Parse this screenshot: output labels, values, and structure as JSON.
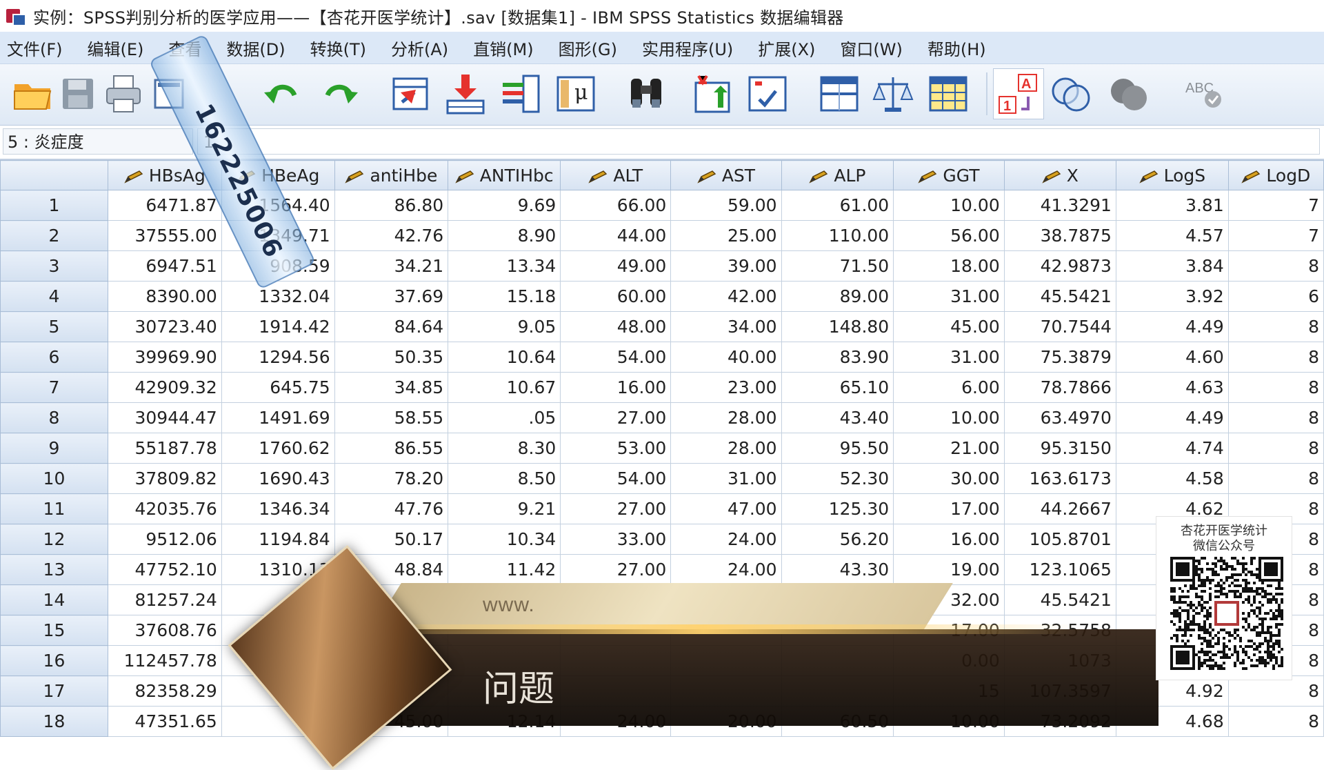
{
  "window": {
    "title": "实例：SPSS判别分析的医学应用——【杏花开医学统计】.sav [数据集1] - IBM SPSS Statistics 数据编辑器"
  },
  "menu": [
    "文件(F)",
    "编辑(E)",
    "查看",
    "数据(D)",
    "转换(T)",
    "分析(A)",
    "直销(M)",
    "图形(G)",
    "实用程序(U)",
    "扩展(X)",
    "窗口(W)",
    "帮助(H)"
  ],
  "toolbar": {
    "icons": [
      "open-folder-icon",
      "save-icon",
      "print-icon",
      "dialog-recall-icon",
      "undo-icon",
      "redo-icon",
      "go-to-case-icon",
      "go-to-variable-icon",
      "variables-icon",
      "run-descriptives-icon",
      "find-icon",
      "insert-cases-icon",
      "insert-variable-icon",
      "split-file-icon",
      "weight-cases-icon",
      "select-cases-icon",
      "value-labels-icon",
      "use-variable-sets-icon",
      "show-all-variables-icon",
      "spell-check-icon"
    ]
  },
  "cell_reference": {
    "label": "5 : 炎症度",
    "value": "1"
  },
  "grid": {
    "columns": [
      "HBsAg",
      "HBeAg",
      "antiHbe",
      "ANTIHbc",
      "ALT",
      "AST",
      "ALP",
      "GGT",
      "X",
      "LogS",
      "LogD"
    ],
    "rows": [
      {
        "n": "1",
        "cells": [
          "6471.87",
          "1564.40",
          "86.80",
          "9.69",
          "66.00",
          "59.00",
          "61.00",
          "10.00",
          "41.3291",
          "3.81",
          "7"
        ]
      },
      {
        "n": "2",
        "cells": [
          "37555.00",
          "1349.71",
          "42.76",
          "8.90",
          "44.00",
          "25.00",
          "110.00",
          "56.00",
          "38.7875",
          "4.57",
          "7"
        ]
      },
      {
        "n": "3",
        "cells": [
          "6947.51",
          "908.59",
          "34.21",
          "13.34",
          "49.00",
          "39.00",
          "71.50",
          "18.00",
          "42.9873",
          "3.84",
          "8"
        ]
      },
      {
        "n": "4",
        "cells": [
          "8390.00",
          "1332.04",
          "37.69",
          "15.18",
          "60.00",
          "42.00",
          "89.00",
          "31.00",
          "45.5421",
          "3.92",
          "6"
        ]
      },
      {
        "n": "5",
        "cells": [
          "30723.40",
          "1914.42",
          "84.64",
          "9.05",
          "48.00",
          "34.00",
          "148.80",
          "45.00",
          "70.7544",
          "4.49",
          "8"
        ]
      },
      {
        "n": "6",
        "cells": [
          "39969.90",
          "1294.56",
          "50.35",
          "10.64",
          "54.00",
          "40.00",
          "83.90",
          "31.00",
          "75.3879",
          "4.60",
          "8"
        ]
      },
      {
        "n": "7",
        "cells": [
          "42909.32",
          "645.75",
          "34.85",
          "10.67",
          "16.00",
          "23.00",
          "65.10",
          "6.00",
          "78.7866",
          "4.63",
          "8"
        ]
      },
      {
        "n": "8",
        "cells": [
          "30944.47",
          "1491.69",
          "58.55",
          ".05",
          "27.00",
          "28.00",
          "43.40",
          "10.00",
          "63.4970",
          "4.49",
          "8"
        ]
      },
      {
        "n": "9",
        "cells": [
          "55187.78",
          "1760.62",
          "86.55",
          "8.30",
          "53.00",
          "28.00",
          "95.50",
          "21.00",
          "95.3150",
          "4.74",
          "8"
        ]
      },
      {
        "n": "10",
        "cells": [
          "37809.82",
          "1690.43",
          "78.20",
          "8.50",
          "54.00",
          "31.00",
          "52.30",
          "30.00",
          "163.6173",
          "4.58",
          "8"
        ]
      },
      {
        "n": "11",
        "cells": [
          "42035.76",
          "1346.34",
          "47.76",
          "9.21",
          "27.00",
          "47.00",
          "125.30",
          "17.00",
          "44.2667",
          "4.62",
          "8"
        ]
      },
      {
        "n": "12",
        "cells": [
          "9512.06",
          "1194.84",
          "50.17",
          "10.34",
          "33.00",
          "24.00",
          "56.20",
          "16.00",
          "105.8701",
          "",
          "8"
        ]
      },
      {
        "n": "13",
        "cells": [
          "47752.10",
          "1310.13",
          "48.84",
          "11.42",
          "27.00",
          "24.00",
          "43.30",
          "19.00",
          "123.1065",
          "",
          "8"
        ]
      },
      {
        "n": "14",
        "cells": [
          "81257.24",
          "160",
          "",
          "",
          "",
          "",
          "",
          "32.00",
          "45.5421",
          "",
          "8"
        ]
      },
      {
        "n": "15",
        "cells": [
          "37608.76",
          "",
          "",
          "",
          "",
          "",
          "",
          "17.00",
          "32.5758",
          "",
          "8"
        ]
      },
      {
        "n": "16",
        "cells": [
          "112457.78",
          "",
          "",
          "",
          "",
          "",
          "",
          "0.00",
          "1073",
          "",
          "8"
        ]
      },
      {
        "n": "17",
        "cells": [
          "82358.29",
          "",
          "",
          "",
          "",
          "",
          "",
          "15",
          "107.3597",
          "4.92",
          "8"
        ]
      },
      {
        "n": "18",
        "cells": [
          "47351.65",
          "8",
          "45.00",
          "12.14",
          "24.00",
          "20.00",
          "60.50",
          "10.00",
          "73.2092",
          "4.68",
          "8"
        ]
      }
    ]
  },
  "overlays": {
    "watermark_tag": "162225006",
    "banner_url": "www.",
    "banner_text": "问题",
    "qr_line1": "杏花开医学统计",
    "qr_line2": "微信公众号"
  }
}
